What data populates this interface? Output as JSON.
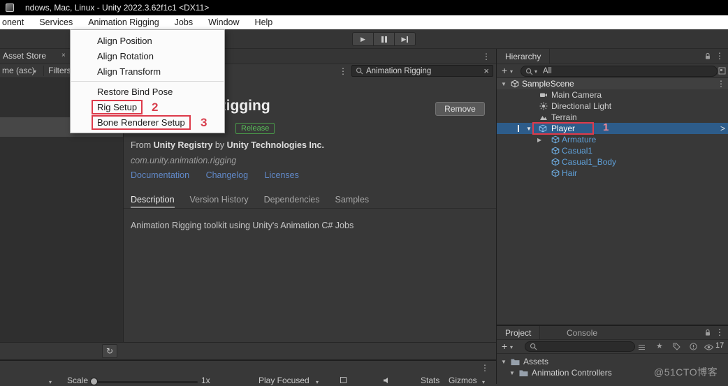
{
  "glyphs": {
    "kebab": "⋮",
    "caret_down": "▾",
    "tri_open": "▼",
    "tri_closed": "▶",
    "play": "▶",
    "clear_x": "×",
    "chevron_right": ">",
    "refresh": "↻",
    "plus": "+",
    "star": "★",
    "close_x": "×"
  },
  "annotations": {
    "one": "1",
    "two": "2",
    "three": "3"
  },
  "title_bar": {
    "title": "ndows, Mac, Linux - Unity 2022.3.62f1c1 <DX11>"
  },
  "menu_bar": {
    "items": [
      "onent",
      "Services",
      "Animation Rigging",
      "Jobs",
      "Window",
      "Help"
    ]
  },
  "context_menu": {
    "items": [
      "Align Position",
      "Align Rotation",
      "Align Transform",
      "Restore Bind Pose",
      "Rig Setup",
      "Bone Renderer Setup"
    ]
  },
  "package_manager": {
    "left_tab": "Asset Store",
    "sort_label": "me (asc)",
    "filters_label": "Filters",
    "search_value": "Animation Rigging",
    "title": "Animation Rigging",
    "remove_button": "Remove",
    "release_badge": "Release",
    "from_prefix": "From",
    "registry_name": "Unity Registry",
    "by_word": "by",
    "author_name": "Unity Technologies Inc.",
    "package_id": "com.unity.animation.rigging",
    "links": [
      "Documentation",
      "Changelog",
      "Licenses"
    ],
    "tabs": [
      "Description",
      "Version History",
      "Dependencies",
      "Samples"
    ],
    "description": "Animation Rigging toolkit using Unity's Animation C# Jobs"
  },
  "hierarchy": {
    "tab_label": "Hierarchy",
    "search_filter": "All",
    "items": [
      {
        "label": "SampleScene"
      },
      {
        "label": "Main Camera"
      },
      {
        "label": "Directional Light"
      },
      {
        "label": "Terrain"
      },
      {
        "label": "Player"
      },
      {
        "label": "Armature"
      },
      {
        "label": "Casual1"
      },
      {
        "label": "Casual1_Body"
      },
      {
        "label": "Hair"
      }
    ]
  },
  "project_panel": {
    "tabs": [
      "Project",
      "Console"
    ],
    "hidden_count": "17",
    "rows": [
      {
        "label": "Assets"
      },
      {
        "label": "Animation Controllers"
      }
    ]
  },
  "game_toolbar": {
    "scale_label": "Scale",
    "scale_value": "1x",
    "focus_label": "Play Focused",
    "stats_label": "Stats",
    "gizmos_label": "Gizmos"
  },
  "watermark": "@51CTO博客"
}
